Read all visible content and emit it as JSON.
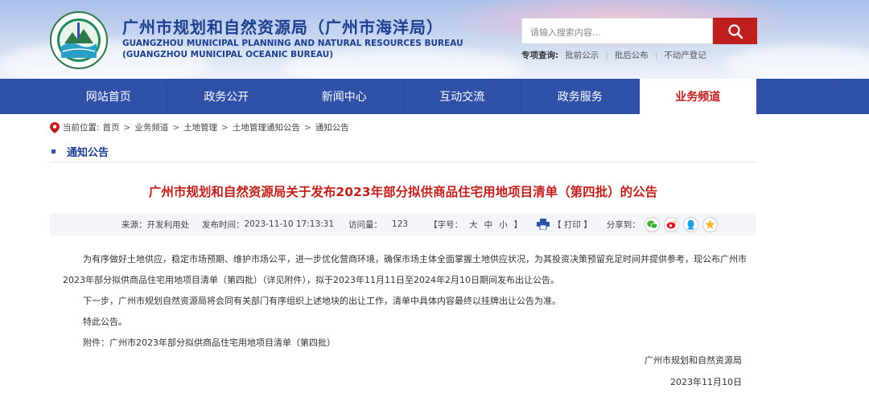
{
  "header": {
    "org_cn": "广州市规划和自然资源局（广州市海洋局）",
    "org_en_1": "GUANGZHOU MUNICIPAL PLANNING AND NATURAL RESOURCES BUREAU",
    "org_en_2": "(GUANGZHOU MUNICIPAL OCEANIC BUREAU)",
    "search_placeholder": "请输入搜索内容...",
    "special_label": "专项查询:",
    "special_links": [
      "批前公示",
      "批后公布",
      "不动产登记"
    ]
  },
  "nav": {
    "items": [
      "网站首页",
      "政务公开",
      "新闻中心",
      "互动交流",
      "政务服务",
      "业务频道"
    ],
    "active_index": 5
  },
  "breadcrumb": {
    "prefix": "当前位置:",
    "items": [
      "首页",
      "业务频道",
      "土地管理",
      "土地管理通知公告",
      "通知公告"
    ]
  },
  "section_title": "通知公告",
  "article": {
    "title": "广州市规划和自然资源局关于发布2023年部分拟供商品住宅用地项目清单（第四批）的公告",
    "meta": {
      "source_label": "来源：",
      "source": "开发利用处",
      "publish_label": "发布时间：",
      "publish_time": "2023-11-10 17:13:31",
      "visits_label": "访问量：",
      "visits": "123",
      "font_label": "【字号：",
      "font_sizes": [
        "大",
        "中",
        "小"
      ],
      "font_close": "】",
      "print": "【  打印  】",
      "share_label": "分享到："
    },
    "paragraphs": [
      "为有序做好土地供应，稳定市场预期、维护市场公平，进一步优化营商环境，确保市场主体全面掌握土地供应状况，为其投资决策预留充足时间并提供参考，现公布广州市2023年部分拟供商品住宅用地项目清单（第四批）（详见附件），拟于2023年11月11日至2024年2月10日期间发布出让公告。",
      "下一步，广州市规划自然资源局将会同有关部门有序组织上述地块的出让工作，清单中具体内容最终以挂牌出让公告为准。",
      "特此公告。",
      "附件：广州市2023年部分拟供商品住宅用地项目清单（第四批）"
    ],
    "signature": "广州市规划和自然资源局",
    "date": "2023年11月10日"
  },
  "colors": {
    "nav_bg": "#2f52a8",
    "title_red": "#c0201d",
    "org_blue": "#1d3f8f"
  }
}
